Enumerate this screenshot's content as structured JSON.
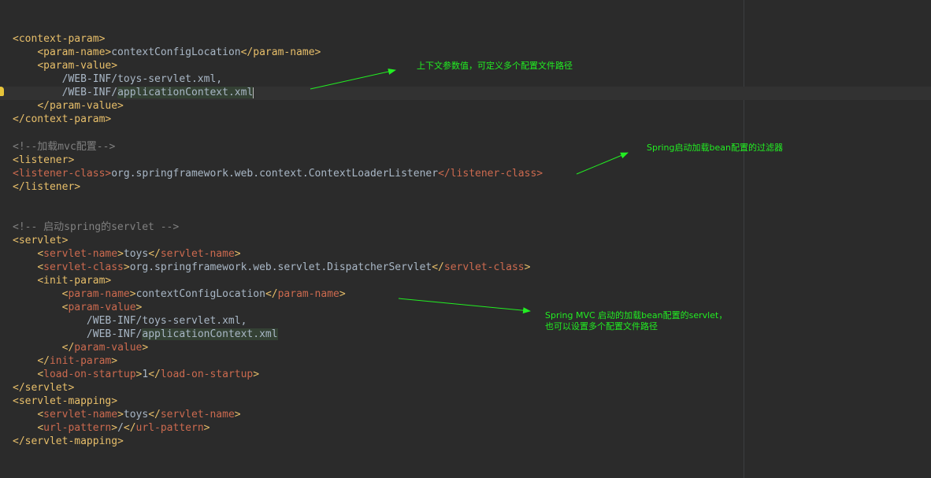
{
  "code": {
    "l1": "<context-param>",
    "l2_open": "<param-name>",
    "l2_text": "contextConfigLocation",
    "l2_close": "</param-name>",
    "l3": "<param-value>",
    "l4": "/WEB-INF/toys-servlet.xml,",
    "l5_a": "/WEB-INF/",
    "l5_b": "applicationContext.xml",
    "l6": "</param-value>",
    "l7": "</context-param>",
    "l8": "<!--加载mvc配置-->",
    "l9": "<listener>",
    "l10_open": "<listener-class>",
    "l10_text": "org.springframework.web.context.ContextLoaderListener",
    "l10_close": "</listener-class>",
    "l11": "</listener>",
    "l12": "<!-- 启动spring的servlet -->",
    "l13": "<servlet>",
    "l14_lt": "<",
    "l14_name": "servlet-name",
    "l14_gt": ">",
    "l14_text": "toys",
    "l14_clt": "</",
    "l14_cname": "servlet-name",
    "l14_cgt": ">",
    "l15_lt": "<",
    "l15_name": "servlet-class",
    "l15_gt": ">",
    "l15_text": "org.springframework.web.servlet.DispatcherServlet",
    "l15_clt": "</",
    "l15_cname": "servlet-class",
    "l15_cgt": ">",
    "l16": "<init-param>",
    "l17_lt": "<",
    "l17_name": "param-name",
    "l17_gt": ">",
    "l17_text": "contextConfigLocation",
    "l17_clt": "</",
    "l17_cname": "param-name",
    "l17_cgt": ">",
    "l18_lt": "<",
    "l18_name": "param-value",
    "l18_gt": ">",
    "l19": "/WEB-INF/toys-servlet.xml,",
    "l20_a": "/WEB-INF/",
    "l20_b": "applicationContext.xml",
    "l21_lt": "</",
    "l21_name": "param-value",
    "l21_gt": ">",
    "l22_lt": "</",
    "l22_name": "init-param",
    "l22_gt": ">",
    "l23_lt": "<",
    "l23_name": "load-on-startup",
    "l23_gt": ">",
    "l23_text": "1",
    "l23_clt": "</",
    "l23_cname": "load-on-startup",
    "l23_cgt": ">",
    "l24": "</servlet>",
    "l25": "<servlet-mapping>",
    "l26_lt": "<",
    "l26_name": "servlet-name",
    "l26_gt": ">",
    "l26_text": "toys",
    "l26_clt": "</",
    "l26_cname": "servlet-name",
    "l26_cgt": ">",
    "l27_lt": "<",
    "l27_name": "url-pattern",
    "l27_gt": ">",
    "l27_text": "/",
    "l27_clt": "</",
    "l27_cname": "url-pattern",
    "l27_cgt": ">",
    "l28": "</servlet-mapping>"
  },
  "annotations": {
    "a1": "上下文参数值，可定义多个配置文件路径",
    "a2": "Spring启动加载bean配置的过滤器",
    "a3_line1": "Spring MVC 启动的加载bean配置的servlet，",
    "a3_line2": "也可以设置多个配置文件路径"
  },
  "colors": {
    "background": "#2b2b2b",
    "tag": "#e8bf6a",
    "tag_error": "#cc6a4f",
    "comment": "#808080",
    "text": "#a9b7c6",
    "annotation": "#22ee22"
  }
}
